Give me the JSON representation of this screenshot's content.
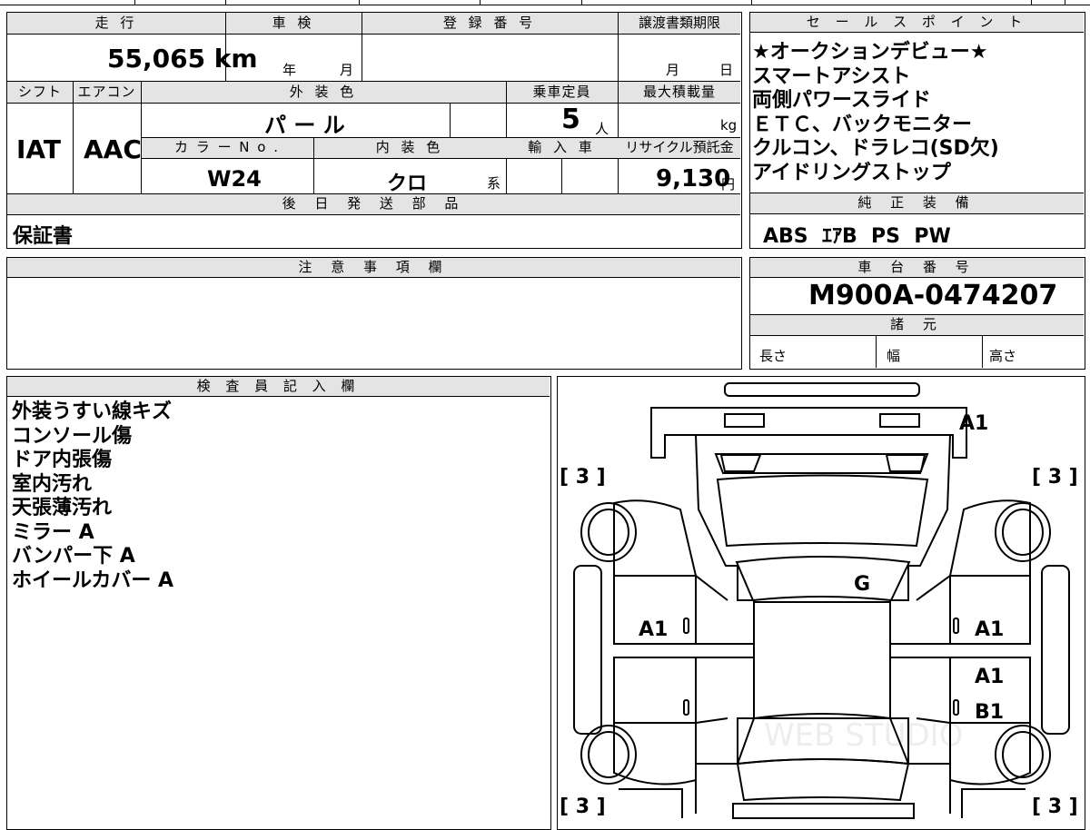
{
  "labels": {
    "mileage": "走 行",
    "inspection": "車 検",
    "registration_no": "登 録 番 号",
    "transfer_doc_deadline": "譲渡書類期限",
    "sales_points": "セ ー ル ス ポ イ ン ト",
    "shift": "シフト",
    "aircon": "エアコン",
    "exterior_color": "外 装 色",
    "capacity": "乗車定員",
    "max_load": "最大積載量",
    "color_no": "カ ラ ー N o .",
    "interior_color": "内 装 色",
    "import_car": "輸 入 車",
    "recycle_fee": "リサイクル預託金",
    "later_parts": "後 日 発 送 部 品",
    "genuine_equipment": "純 正 装 備",
    "notes": "注 意 事 項 欄",
    "chassis_no": "車 台 番 号",
    "specs": "諸 元",
    "length": "長さ",
    "width": "幅",
    "height": "高さ",
    "inspector": "検 査 員 記 入 欄",
    "year_unit": "年",
    "month_unit": "月",
    "day_unit": "日",
    "person_unit": "人",
    "kg_unit": "kg",
    "yen_unit": "円",
    "series_unit": "系"
  },
  "values": {
    "mileage": "55,065 km",
    "shift": "IAT",
    "aircon": "AAC",
    "exterior_color": "パ ー ル",
    "capacity": "5",
    "color_no": "W24",
    "interior_color": "クロ",
    "recycle_fee": "9,130",
    "later_parts": "保証書",
    "genuine_equipment": "ABS  ｴｱB  PS  PW",
    "chassis_no": "M900A-0474207"
  },
  "sales_points": [
    "★オークションデビュー★",
    "スマートアシスト",
    "両側パワースライド",
    "ＥＴＣ、バックモニター",
    "クルコン、ドラレコ(SD欠)",
    "アイドリングストップ"
  ],
  "inspector_notes": [
    "外装うすい線キズ",
    "コンソール傷",
    "ドア内張傷",
    "室内汚れ",
    "天張薄汚れ",
    "ミラー A",
    "バンパー下 A",
    "ホイールカバー A"
  ],
  "diagram": {
    "tires": [
      "[ 3 ]",
      "[ 3 ]",
      "[ 3 ]",
      "[ 3 ]"
    ],
    "marks": {
      "front_right": "A1",
      "roof": "G",
      "left_front_door": "A1",
      "right_front_door": "A1",
      "right_rear_upper": "A1",
      "right_rear_lower": "B1"
    },
    "watermark": "WEB STUDIO"
  }
}
